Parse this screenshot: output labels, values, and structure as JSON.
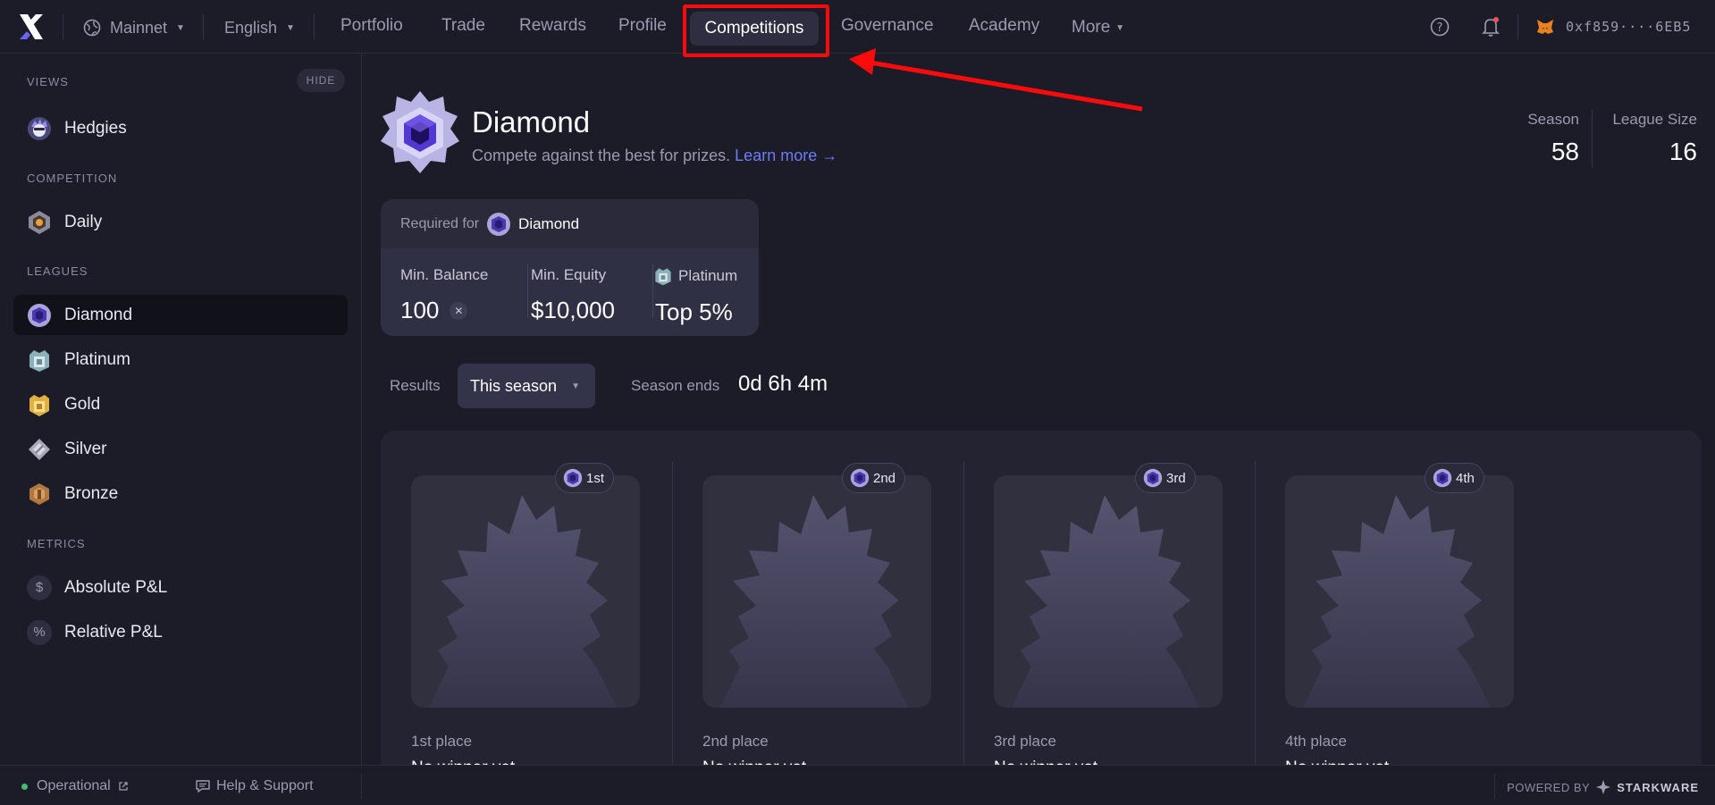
{
  "topbar": {
    "network": "Mainnet",
    "language": "English",
    "nav": [
      "Portfolio",
      "Trade",
      "Rewards",
      "Profile",
      "Competitions",
      "Governance",
      "Academy",
      "More"
    ],
    "active_nav": "Competitions",
    "wallet": "0xf859····6EB5"
  },
  "sidebar": {
    "views_title": "VIEWS",
    "hide_label": "HIDE",
    "views": [
      "Hedgies"
    ],
    "competition_title": "COMPETITION",
    "competition": [
      "Daily"
    ],
    "leagues_title": "LEAGUES",
    "leagues": [
      "Diamond",
      "Platinum",
      "Gold",
      "Silver",
      "Bronze"
    ],
    "active_league": "Diamond",
    "metrics_title": "METRICS",
    "metrics": [
      {
        "icon": "$",
        "label": "Absolute P&L"
      },
      {
        "icon": "%",
        "label": "Relative P&L"
      }
    ]
  },
  "league": {
    "title": "Diamond",
    "subtitle": "Compete against the best for prizes.",
    "learn_more": "Learn more →",
    "season_label": "Season",
    "season_value": "58",
    "size_label": "League Size",
    "size_value": "16"
  },
  "requirements": {
    "required_for": "Required for",
    "league_name": "Diamond",
    "min_balance_label": "Min. Balance",
    "min_balance_value": "100",
    "min_equity_label": "Min. Equity",
    "min_equity_value": "$10,000",
    "platinum_label": "Platinum",
    "platinum_value": "Top 5%"
  },
  "results": {
    "label": "Results",
    "period": "This season",
    "ends_label": "Season ends",
    "ends_value": "0d 6h 4m"
  },
  "podium": [
    {
      "rank": "1st",
      "label": "1st place",
      "name": "No winner yet"
    },
    {
      "rank": "2nd",
      "label": "2nd place",
      "name": "No winner yet"
    },
    {
      "rank": "3rd",
      "label": "3rd place",
      "name": "No winner yet"
    },
    {
      "rank": "4th",
      "label": "4th place",
      "name": "No winner yet"
    }
  ],
  "footer": {
    "status": "Operational",
    "help": "Help & Support",
    "powered_by": "POWERED BY",
    "brand": "STARKWARE"
  },
  "colors": {
    "background": "#1c1c28",
    "accent_link": "#6c7cff",
    "highlight": "#ff0a0a",
    "status_ok": "#3fbf6f"
  }
}
